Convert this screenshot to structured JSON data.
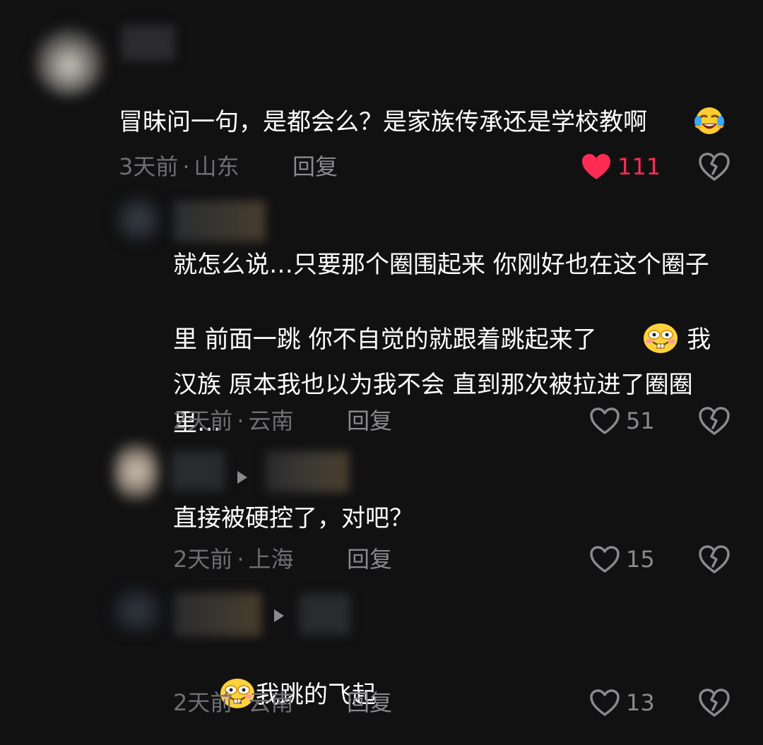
{
  "comments": [
    {
      "text": "冒昧问一句，是都会么？是家族传承还是学校教啊",
      "emoji": "laugh-cry-emoji",
      "time": "3天前",
      "location": "山东",
      "reply_label": "回复",
      "likes": "111",
      "liked": true
    },
    {
      "text": "就怎么说…只要那个圈围起来 你刚好也在这个圈子里 前面一跳 你不自觉的就跟着跳起来了",
      "text_after_emoji": " 我汉族 原本我也以为我不会 直到那次被拉进了圈圈里…",
      "emoji": "buck-teeth-emoji",
      "time": "2天前",
      "location": "云南",
      "reply_label": "回复",
      "likes": "51",
      "liked": false
    },
    {
      "text": "直接被硬控了，对吧？",
      "time": "2天前",
      "location": "上海",
      "reply_label": "回复",
      "likes": "15",
      "liked": false
    },
    {
      "text": "我跳的飞起",
      "emoji": "buck-teeth-emoji",
      "time": "2天前",
      "location": "云南",
      "reply_label": "回复",
      "likes": "13",
      "liked": false
    }
  ],
  "meta_separator": "·",
  "colors": {
    "background": "#111112",
    "text": "#ffffff",
    "meta": "#6f6f73",
    "liked": "#fe2c55",
    "icon": "#8a8a8e"
  }
}
